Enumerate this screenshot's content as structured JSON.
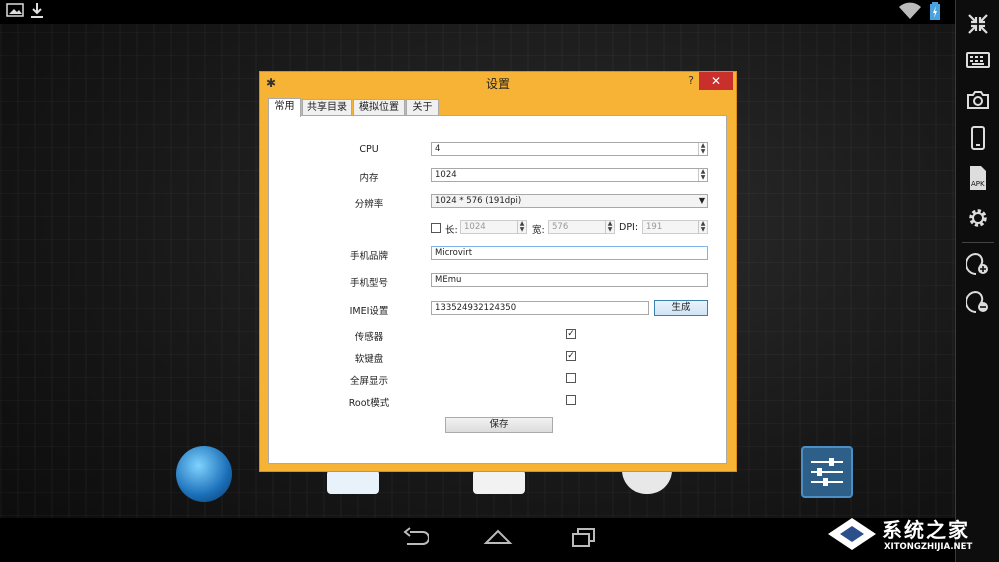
{
  "status_bar": {
    "left_icons": [
      "image-icon",
      "download-icon"
    ],
    "right_icons": [
      "wifi-icon",
      "battery-icon"
    ]
  },
  "nav_bar": {
    "back": "back-icon",
    "home": "home-icon",
    "recents": "recent-apps-icon"
  },
  "sidebar_buttons": [
    "shrink-icon",
    "keyboard-icon",
    "camera-icon",
    "rotate-icon",
    "apk-icon",
    "gear-icon",
    "volume-up-icon",
    "volume-down-icon"
  ],
  "dialog": {
    "title": "设置",
    "help": "?",
    "close": "✕",
    "tabs": [
      "常用",
      "共享目录",
      "模拟位置",
      "关于"
    ],
    "rows": {
      "cpu": {
        "label": "CPU",
        "value": "4"
      },
      "memory": {
        "label": "内存",
        "value": "1024"
      },
      "resolution": {
        "label": "分辨率",
        "value": "1024 * 576 (191dpi)"
      },
      "custom": {
        "long_label": "长:",
        "long_value": "1024",
        "wide_label": "宽:",
        "wide_value": "576",
        "dpi_label": "DPI:",
        "dpi_value": "191",
        "checked": false
      },
      "brand": {
        "label": "手机品牌",
        "value": "Microvirt"
      },
      "model": {
        "label": "手机型号",
        "value": "MEmu"
      },
      "imei": {
        "label": "IMEI设置",
        "value": "133524932124350",
        "button": "生成"
      },
      "sensor": {
        "label": "传感器",
        "checked": true
      },
      "soft_keyboard": {
        "label": "软键盘",
        "checked": true
      },
      "fullscreen": {
        "label": "全屏显示",
        "checked": false
      },
      "root": {
        "label": "Root模式",
        "checked": false
      }
    },
    "save": "保存"
  },
  "watermark": {
    "brand": "系统之家",
    "url": "XITONGZHIJIA.NET"
  },
  "colors": {
    "dialog_frame": "#f7b335",
    "close_button": "#c9302c",
    "accent_blue": "#3c7fb1"
  }
}
